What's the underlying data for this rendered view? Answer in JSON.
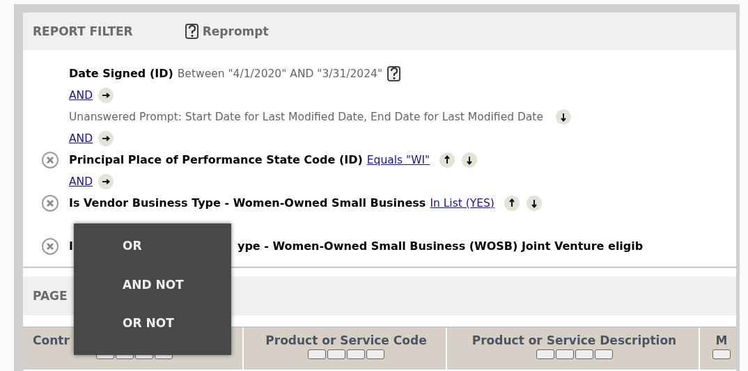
{
  "report_filter": {
    "title": "REPORT FILTER",
    "reprompt": "Reprompt"
  },
  "filters": [
    {
      "kind": "condition",
      "removable": false,
      "name_parts": [
        "Date Signed (ID)"
      ],
      "operator": "Between \"4/1/2020\" AND \"3/31/2024\"",
      "link": false,
      "help": true,
      "up": false,
      "down": false
    },
    {
      "kind": "connector",
      "label": "AND"
    },
    {
      "kind": "prompt",
      "text": "Unanswered Prompt: Start Date for Last Modified Date, End Date for Last Modified Date",
      "down": true
    },
    {
      "kind": "connector",
      "label": "AND"
    },
    {
      "kind": "condition",
      "removable": true,
      "name_parts": [
        "Principal Place of Performance State Code (ID)"
      ],
      "operator": "Equals \"WI\"",
      "link": true,
      "help": false,
      "up": true,
      "down": true
    },
    {
      "kind": "connector",
      "label": "AND"
    },
    {
      "kind": "condition",
      "removable": true,
      "name_parts": [
        "Is Vendor Business Type - Women-Owned Small Business"
      ],
      "operator": "In List (YES)",
      "link": true,
      "help": false,
      "up": true,
      "down": true
    },
    {
      "kind": "spacer"
    },
    {
      "kind": "condition",
      "removable": true,
      "name_parts": [
        "I",
        "ype - Women-Owned Small Business (WOSB) Joint Venture eligib"
      ],
      "help": false,
      "up": false,
      "down": false
    }
  ],
  "page_section": {
    "title": "PAGE"
  },
  "table": {
    "columns": [
      {
        "title_parts": [
          "Contr"
        ]
      },
      {
        "title_parts": [
          "Product or Service Code"
        ]
      },
      {
        "title_parts": [
          "Product or Service Description"
        ]
      },
      {
        "title_parts": [
          "M"
        ]
      }
    ]
  },
  "connector_menu": {
    "items": [
      "OR",
      "AND NOT",
      "OR NOT"
    ]
  }
}
